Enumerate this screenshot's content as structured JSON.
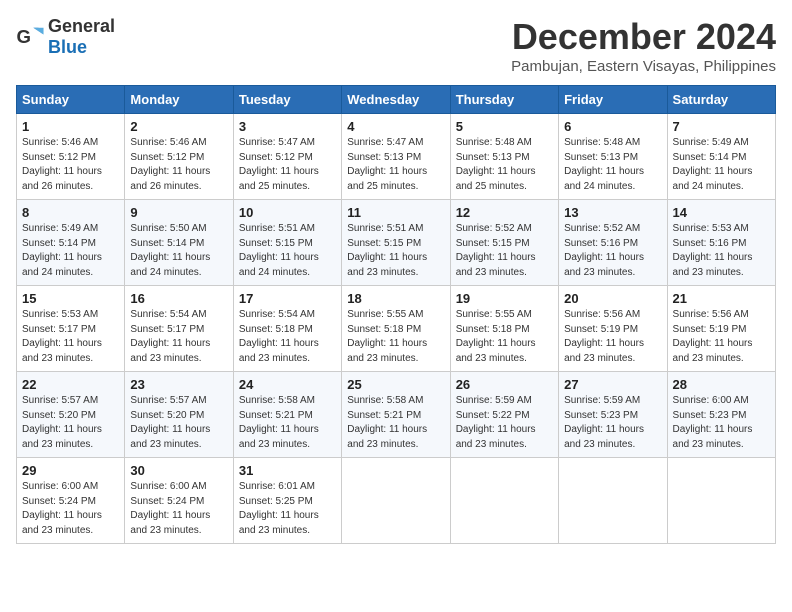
{
  "header": {
    "logo_general": "General",
    "logo_blue": "Blue",
    "month_title": "December 2024",
    "subtitle": "Pambujan, Eastern Visayas, Philippines"
  },
  "columns": [
    "Sunday",
    "Monday",
    "Tuesday",
    "Wednesday",
    "Thursday",
    "Friday",
    "Saturday"
  ],
  "weeks": [
    [
      {
        "day": "1",
        "sunrise": "5:46 AM",
        "sunset": "5:12 PM",
        "daylight": "11 hours and 26 minutes."
      },
      {
        "day": "2",
        "sunrise": "5:46 AM",
        "sunset": "5:12 PM",
        "daylight": "11 hours and 26 minutes."
      },
      {
        "day": "3",
        "sunrise": "5:47 AM",
        "sunset": "5:12 PM",
        "daylight": "11 hours and 25 minutes."
      },
      {
        "day": "4",
        "sunrise": "5:47 AM",
        "sunset": "5:13 PM",
        "daylight": "11 hours and 25 minutes."
      },
      {
        "day": "5",
        "sunrise": "5:48 AM",
        "sunset": "5:13 PM",
        "daylight": "11 hours and 25 minutes."
      },
      {
        "day": "6",
        "sunrise": "5:48 AM",
        "sunset": "5:13 PM",
        "daylight": "11 hours and 24 minutes."
      },
      {
        "day": "7",
        "sunrise": "5:49 AM",
        "sunset": "5:14 PM",
        "daylight": "11 hours and 24 minutes."
      }
    ],
    [
      {
        "day": "8",
        "sunrise": "5:49 AM",
        "sunset": "5:14 PM",
        "daylight": "11 hours and 24 minutes."
      },
      {
        "day": "9",
        "sunrise": "5:50 AM",
        "sunset": "5:14 PM",
        "daylight": "11 hours and 24 minutes."
      },
      {
        "day": "10",
        "sunrise": "5:51 AM",
        "sunset": "5:15 PM",
        "daylight": "11 hours and 24 minutes."
      },
      {
        "day": "11",
        "sunrise": "5:51 AM",
        "sunset": "5:15 PM",
        "daylight": "11 hours and 23 minutes."
      },
      {
        "day": "12",
        "sunrise": "5:52 AM",
        "sunset": "5:15 PM",
        "daylight": "11 hours and 23 minutes."
      },
      {
        "day": "13",
        "sunrise": "5:52 AM",
        "sunset": "5:16 PM",
        "daylight": "11 hours and 23 minutes."
      },
      {
        "day": "14",
        "sunrise": "5:53 AM",
        "sunset": "5:16 PM",
        "daylight": "11 hours and 23 minutes."
      }
    ],
    [
      {
        "day": "15",
        "sunrise": "5:53 AM",
        "sunset": "5:17 PM",
        "daylight": "11 hours and 23 minutes."
      },
      {
        "day": "16",
        "sunrise": "5:54 AM",
        "sunset": "5:17 PM",
        "daylight": "11 hours and 23 minutes."
      },
      {
        "day": "17",
        "sunrise": "5:54 AM",
        "sunset": "5:18 PM",
        "daylight": "11 hours and 23 minutes."
      },
      {
        "day": "18",
        "sunrise": "5:55 AM",
        "sunset": "5:18 PM",
        "daylight": "11 hours and 23 minutes."
      },
      {
        "day": "19",
        "sunrise": "5:55 AM",
        "sunset": "5:18 PM",
        "daylight": "11 hours and 23 minutes."
      },
      {
        "day": "20",
        "sunrise": "5:56 AM",
        "sunset": "5:19 PM",
        "daylight": "11 hours and 23 minutes."
      },
      {
        "day": "21",
        "sunrise": "5:56 AM",
        "sunset": "5:19 PM",
        "daylight": "11 hours and 23 minutes."
      }
    ],
    [
      {
        "day": "22",
        "sunrise": "5:57 AM",
        "sunset": "5:20 PM",
        "daylight": "11 hours and 23 minutes."
      },
      {
        "day": "23",
        "sunrise": "5:57 AM",
        "sunset": "5:20 PM",
        "daylight": "11 hours and 23 minutes."
      },
      {
        "day": "24",
        "sunrise": "5:58 AM",
        "sunset": "5:21 PM",
        "daylight": "11 hours and 23 minutes."
      },
      {
        "day": "25",
        "sunrise": "5:58 AM",
        "sunset": "5:21 PM",
        "daylight": "11 hours and 23 minutes."
      },
      {
        "day": "26",
        "sunrise": "5:59 AM",
        "sunset": "5:22 PM",
        "daylight": "11 hours and 23 minutes."
      },
      {
        "day": "27",
        "sunrise": "5:59 AM",
        "sunset": "5:23 PM",
        "daylight": "11 hours and 23 minutes."
      },
      {
        "day": "28",
        "sunrise": "6:00 AM",
        "sunset": "5:23 PM",
        "daylight": "11 hours and 23 minutes."
      }
    ],
    [
      {
        "day": "29",
        "sunrise": "6:00 AM",
        "sunset": "5:24 PM",
        "daylight": "11 hours and 23 minutes."
      },
      {
        "day": "30",
        "sunrise": "6:00 AM",
        "sunset": "5:24 PM",
        "daylight": "11 hours and 23 minutes."
      },
      {
        "day": "31",
        "sunrise": "6:01 AM",
        "sunset": "5:25 PM",
        "daylight": "11 hours and 23 minutes."
      },
      null,
      null,
      null,
      null
    ]
  ],
  "labels": {
    "sunrise": "Sunrise:",
    "sunset": "Sunset:",
    "daylight": "Daylight:"
  }
}
